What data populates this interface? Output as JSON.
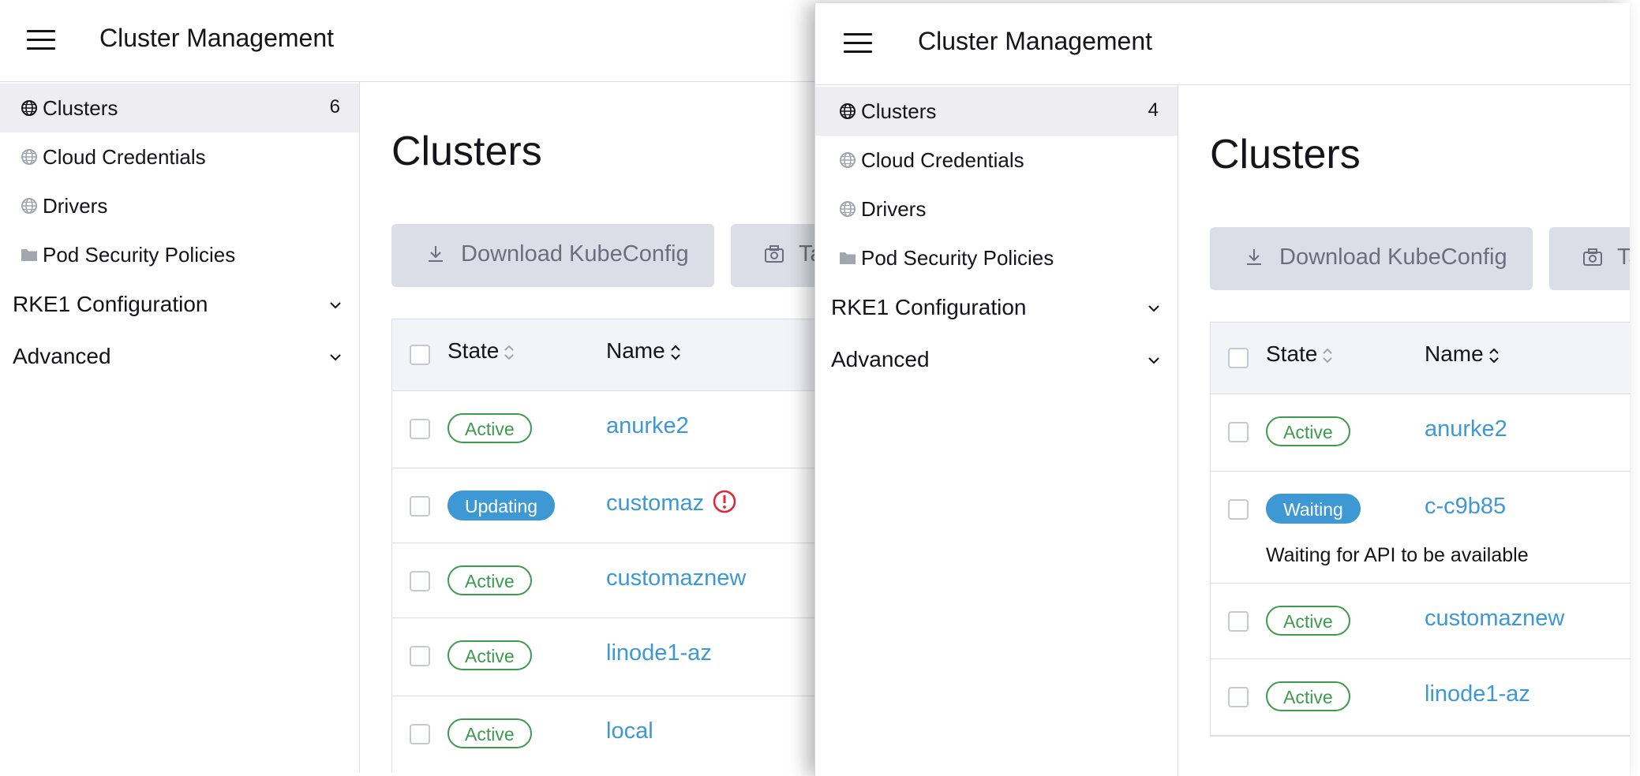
{
  "panel_a": {
    "app_title": "Cluster Management",
    "nav": [
      {
        "label": "Clusters",
        "count": "6",
        "icon": "globe-icon",
        "active": true
      },
      {
        "label": "Cloud Credentials",
        "icon": "globe-icon"
      },
      {
        "label": "Drivers",
        "icon": "globe-icon"
      },
      {
        "label": "Pod Security Policies",
        "icon": "folder-icon"
      }
    ],
    "groups": [
      {
        "label": "RKE1 Configuration"
      },
      {
        "label": "Advanced"
      }
    ],
    "page_title": "Clusters",
    "buttons": {
      "download": "Download KubeConfig",
      "snapshot": "Ta"
    },
    "columns": {
      "state": "State",
      "name": "Name"
    },
    "rows": [
      {
        "state": "Active",
        "name": "anurke2"
      },
      {
        "state": "Updating",
        "name": "customaz",
        "icon": "alert-circle-icon"
      },
      {
        "state": "Active",
        "name": "customaznew"
      },
      {
        "state": "Active",
        "name": "linode1-az"
      },
      {
        "state": "Active",
        "name": "local"
      }
    ]
  },
  "panel_b": {
    "app_title": "Cluster Management",
    "nav": [
      {
        "label": "Clusters",
        "count": "4",
        "icon": "globe-icon",
        "active": true
      },
      {
        "label": "Cloud Credentials",
        "icon": "globe-icon"
      },
      {
        "label": "Drivers",
        "icon": "globe-icon"
      },
      {
        "label": "Pod Security Policies",
        "icon": "folder-icon"
      }
    ],
    "groups": [
      {
        "label": "RKE1 Configuration"
      },
      {
        "label": "Advanced"
      }
    ],
    "page_title": "Clusters",
    "buttons": {
      "download": "Download KubeConfig",
      "snapshot": "Ta"
    },
    "columns": {
      "state": "State",
      "name": "Name"
    },
    "rows": [
      {
        "state": "Active",
        "name": "anurke2"
      },
      {
        "state": "Waiting",
        "name": "c-c9b85",
        "message": "Waiting for API to be available"
      },
      {
        "state": "Active",
        "name": "customaznew"
      },
      {
        "state": "Active",
        "name": "linode1-az"
      }
    ]
  },
  "colors": {
    "link": "#3d98d3",
    "active_badge": "#3d9a4f",
    "transition_badge": "#3d98d3",
    "error": "#e0283b",
    "nav_active_bg": "#ededf2",
    "button_bg": "#dcdee7"
  }
}
